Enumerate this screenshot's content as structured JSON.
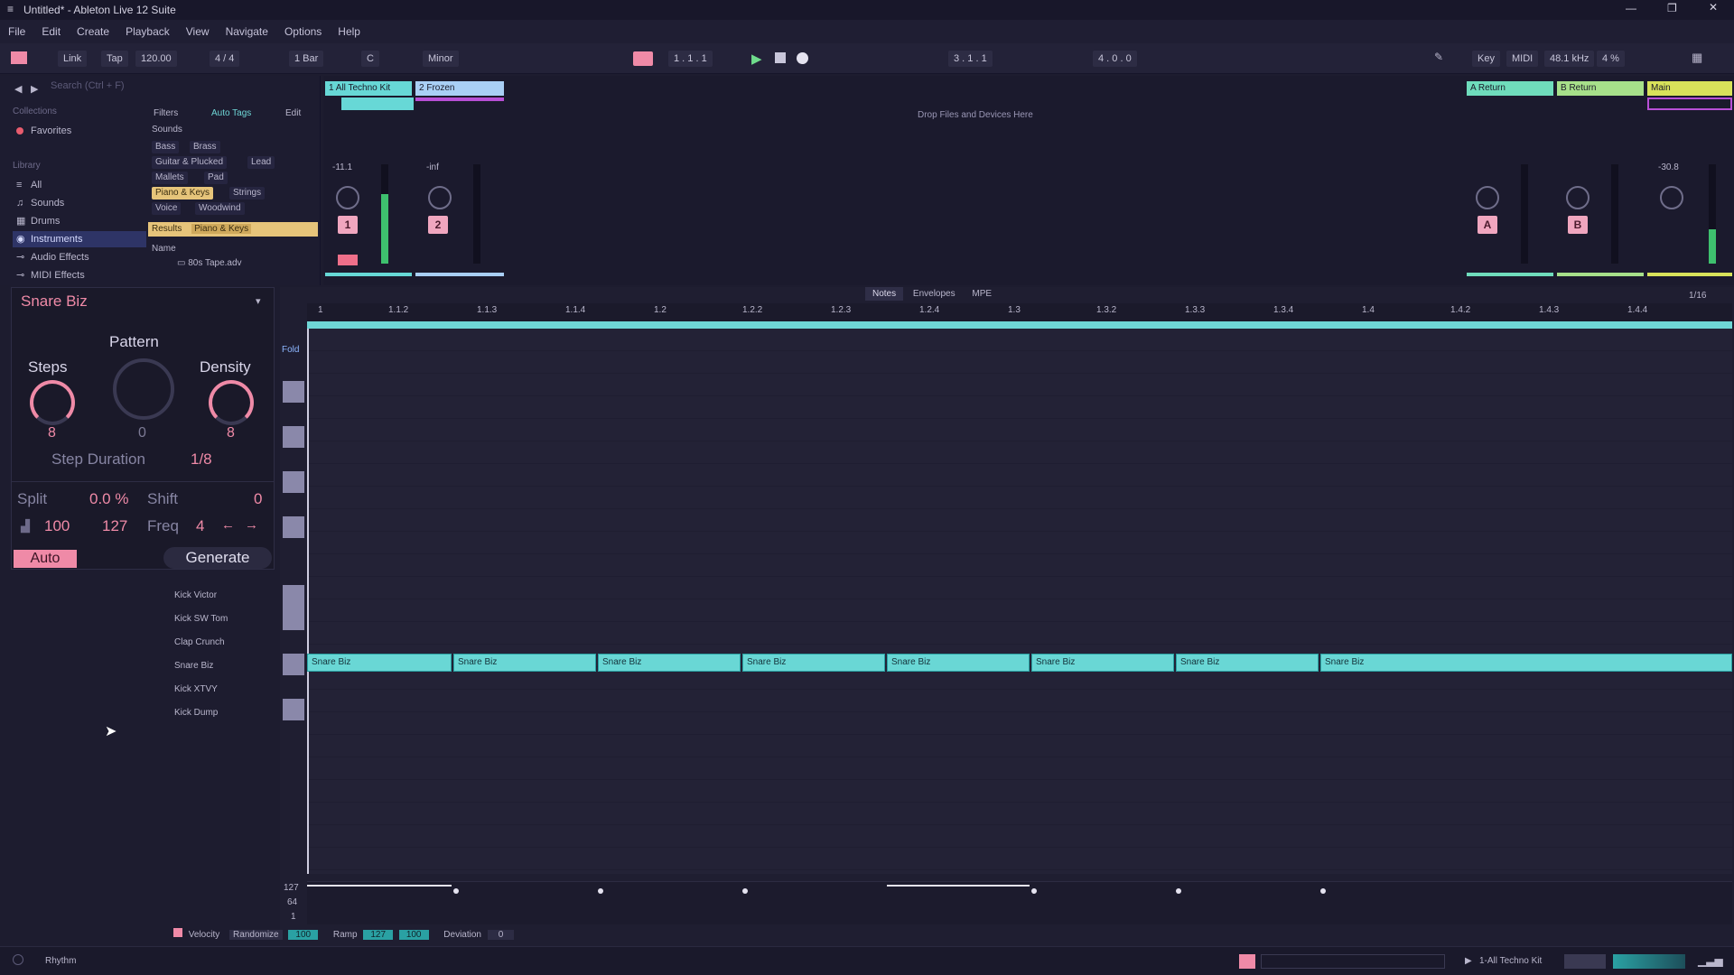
{
  "window": {
    "title": "Untitled* - Ableton Live 12 Suite"
  },
  "menu": [
    "File",
    "Edit",
    "Create",
    "Playback",
    "View",
    "Navigate",
    "Options",
    "Help"
  ],
  "transport": {
    "link": "Link",
    "tap": "Tap",
    "tempo": "120.00",
    "signature": "4 / 4",
    "quantize": "1 Bar",
    "key": "C",
    "scale": "Minor",
    "position": "1 . 1 . 1",
    "loop_start": "3 . 1 . 1",
    "loop_length": "4 . 0 . 0",
    "key_btn": "Key",
    "midi_btn": "MIDI",
    "sample_rate": "48.1 kHz",
    "cpu": "4 %"
  },
  "browser": {
    "search_placeholder": "Search (Ctrl + F)",
    "collections_title": "Collections",
    "favorites": "Favorites",
    "library_title": "Library",
    "items": [
      "All",
      "Sounds",
      "Drums",
      "Instruments",
      "Audio Effects",
      "MIDI Effects"
    ],
    "filters_label": "Filters",
    "autotags_label": "Auto Tags",
    "edit_label": "Edit",
    "sounds_label": "Sounds",
    "tags": [
      "Bass",
      "Brass",
      "Guitar & Plucked",
      "Lead",
      "Mallets",
      "Pad",
      "Piano & Keys",
      "Strings",
      "Voice",
      "Woodwind"
    ],
    "results_label": "Results",
    "results_value": "Piano & Keys",
    "name_col": "Name",
    "file": "80s Tape.adv"
  },
  "session": {
    "tracks": [
      {
        "name": "1 All Techno Kit",
        "color": "#67d8d6",
        "number": "1",
        "volume": "-11.1"
      },
      {
        "name": "2 Frozen",
        "color": "#a9cff5",
        "number": "2",
        "volume": "-inf"
      }
    ],
    "drop_text": "Drop Files and Devices Here",
    "returns": [
      {
        "name": "A Return",
        "color": "#6fdcbc",
        "letter": "A"
      },
      {
        "name": "B Return",
        "color": "#a7e08a",
        "letter": "B"
      },
      {
        "name": "Main",
        "color": "#d8e25a",
        "volume": "-30.8"
      }
    ]
  },
  "device": {
    "title": "Snare Biz",
    "pattern_label": "Pattern",
    "steps_label": "Steps",
    "steps_value": "8",
    "pattern_value": "0",
    "density_label": "Density",
    "density_value": "8",
    "step_duration_label": "Step Duration",
    "step_duration_value": "1/8",
    "split_label": "Split",
    "split_value": "0.0 %",
    "shift_label": "Shift",
    "shift_value": "0",
    "vel_min": "100",
    "vel_max": "127",
    "freq_label": "Freq",
    "freq_value": "4",
    "auto_label": "Auto",
    "generate_label": "Generate"
  },
  "pianoroll": {
    "tabs": [
      "Notes",
      "Envelopes",
      "MPE"
    ],
    "grid": "1/16",
    "ruler": [
      "1",
      "1.1.2",
      "1.1.3",
      "1.1.4",
      "1.2",
      "1.2.2",
      "1.2.3",
      "1.2.4",
      "1.3",
      "1.3.2",
      "1.3.3",
      "1.3.4",
      "1.4",
      "1.4.2",
      "1.4.3",
      "1.4.4"
    ],
    "fold_label": "Fold",
    "rows": [
      "Kick Victor",
      "Kick SW Tom",
      "Clap Crunch",
      "Snare Biz",
      "Kick XTVY",
      "Kick Dump"
    ],
    "note_label": "Snare Biz",
    "vel_axis": [
      "127",
      "64",
      "1"
    ],
    "footer": {
      "velocity": "Velocity",
      "randomize": "Randomize",
      "rand_val": "100",
      "ramp": "Ramp",
      "ramp_a": "127",
      "ramp_b": "100",
      "deviation": "Deviation",
      "dev_val": "0"
    }
  },
  "status": {
    "left": "Rhythm",
    "right": "1-All Techno Kit"
  }
}
